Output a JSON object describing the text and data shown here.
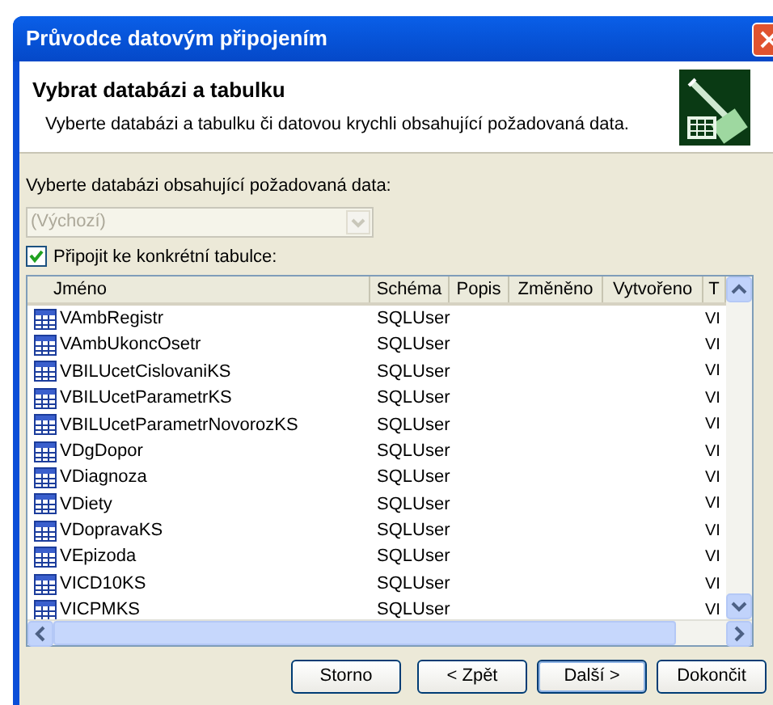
{
  "window": {
    "title": "Průvodce datovým připojením"
  },
  "header": {
    "title": "Vybrat databázi a tabulku",
    "subtitle": "Vyberte databázi a tabulku či datovou krychli obsahující požadovaná data."
  },
  "database": {
    "label": "Vyberte databázi obsahující požadovaná data:",
    "value": "(Výchozí)",
    "disabled": true
  },
  "connect_table": {
    "label": "Připojit ke konkrétní tabulce:",
    "checked": true
  },
  "table": {
    "columns": [
      "Jméno",
      "Schéma",
      "Popis",
      "Změněno",
      "Vytvořeno",
      "T"
    ],
    "rows": [
      {
        "name": "VAmbRegistr",
        "schema": "SQLUser",
        "type": "VI"
      },
      {
        "name": "VAmbUkoncOsetr",
        "schema": "SQLUser",
        "type": "VI"
      },
      {
        "name": "VBILUcetCislovaniKS",
        "schema": "SQLUser",
        "type": "VI"
      },
      {
        "name": "VBILUcetParametrKS",
        "schema": "SQLUser",
        "type": "VI"
      },
      {
        "name": "VBILUcetParametrNovorozKS",
        "schema": "SQLUser",
        "type": "VI"
      },
      {
        "name": "VDgDopor",
        "schema": "SQLUser",
        "type": "VI"
      },
      {
        "name": "VDiagnoza",
        "schema": "SQLUser",
        "type": "VI"
      },
      {
        "name": "VDiety",
        "schema": "SQLUser",
        "type": "VI"
      },
      {
        "name": "VDopravaKS",
        "schema": "SQLUser",
        "type": "VI"
      },
      {
        "name": "VEpizoda",
        "schema": "SQLUser",
        "type": "VI"
      },
      {
        "name": "VICD10KS",
        "schema": "SQLUser",
        "type": "VI"
      },
      {
        "name": "VICPMKS",
        "schema": "SQLUser",
        "type": "VI"
      }
    ]
  },
  "buttons": [
    {
      "label": "Storno",
      "default": false
    },
    {
      "label": "< Zpět",
      "default": false
    },
    {
      "label": "Další >",
      "default": true
    },
    {
      "label": "Dokončit",
      "default": false
    }
  ]
}
